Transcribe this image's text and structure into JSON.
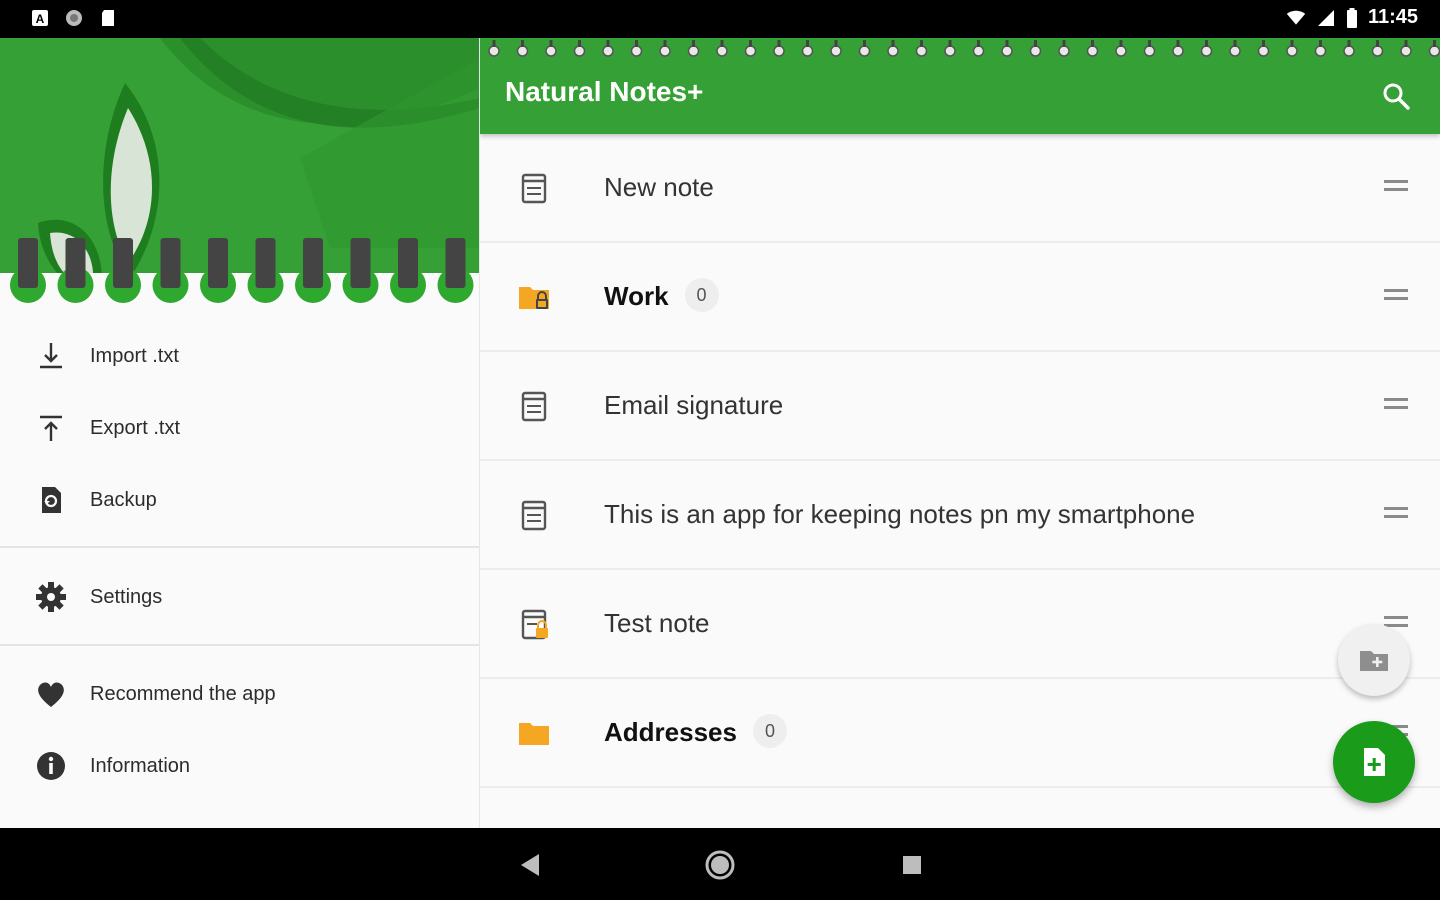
{
  "status_bar": {
    "time": "11:45"
  },
  "app": {
    "title": "Natural Notes+"
  },
  "drawer": {
    "items": [
      {
        "label": "Import .txt",
        "icon": "import-icon"
      },
      {
        "label": "Export .txt",
        "icon": "export-icon"
      },
      {
        "label": "Backup",
        "icon": "backup-icon"
      },
      {
        "label": "Settings",
        "icon": "gear-icon"
      },
      {
        "label": "Recommend the app",
        "icon": "heart-icon"
      },
      {
        "label": "Information",
        "icon": "info-icon"
      }
    ]
  },
  "notes": [
    {
      "label": "New note",
      "type": "note",
      "locked": false
    },
    {
      "label": "Work",
      "type": "folder",
      "locked": true,
      "count": "0"
    },
    {
      "label": "Email signature",
      "type": "note",
      "locked": false
    },
    {
      "label": "This is an app for keeping notes pn my smartphone",
      "type": "note",
      "locked": false
    },
    {
      "label": "Test note",
      "type": "note",
      "locked": true
    },
    {
      "label": "Addresses",
      "type": "folder",
      "locked": false,
      "count": "0"
    }
  ],
  "colors": {
    "primary": "#35a035",
    "fab": "#1a9b1a",
    "folder": "#f5a623"
  }
}
